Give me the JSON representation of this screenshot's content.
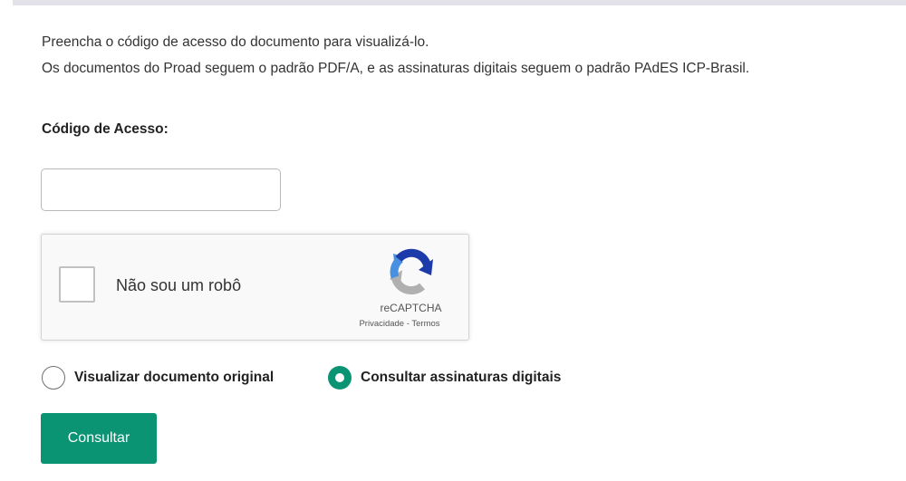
{
  "intro": {
    "line1": "Preencha o código de acesso do documento para visualizá-lo.",
    "line2": "Os documentos do Proad seguem o padrão PDF/A, e as assinaturas digitais seguem o padrão PAdES ICP-Brasil."
  },
  "access_code": {
    "label": "Código de Acesso:",
    "value": "",
    "placeholder": ""
  },
  "recaptcha": {
    "checkbox_label": "Não sou um robô",
    "checked": false,
    "brand": "reCAPTCHA",
    "privacy_link": "Privacidade",
    "separator": " - ",
    "terms_link": "Termos",
    "logo_icon": "recaptcha-logo-icon"
  },
  "options": {
    "selected": "consultar_assinaturas",
    "items": [
      {
        "id": "visualizar_original",
        "label": "Visualizar documento original",
        "checked": false
      },
      {
        "id": "consultar_assinaturas",
        "label": "Consultar assinaturas digitais",
        "checked": true
      }
    ]
  },
  "submit": {
    "label": "Consultar"
  },
  "colors": {
    "accent": "#0a9473",
    "top_bar": "#e2e2e8",
    "recaptcha_bg": "#f9f9f9",
    "logo_blue_dark": "#1c3aa9",
    "logo_blue_light": "#4a90e2",
    "logo_gray": "#b0b0b0"
  }
}
